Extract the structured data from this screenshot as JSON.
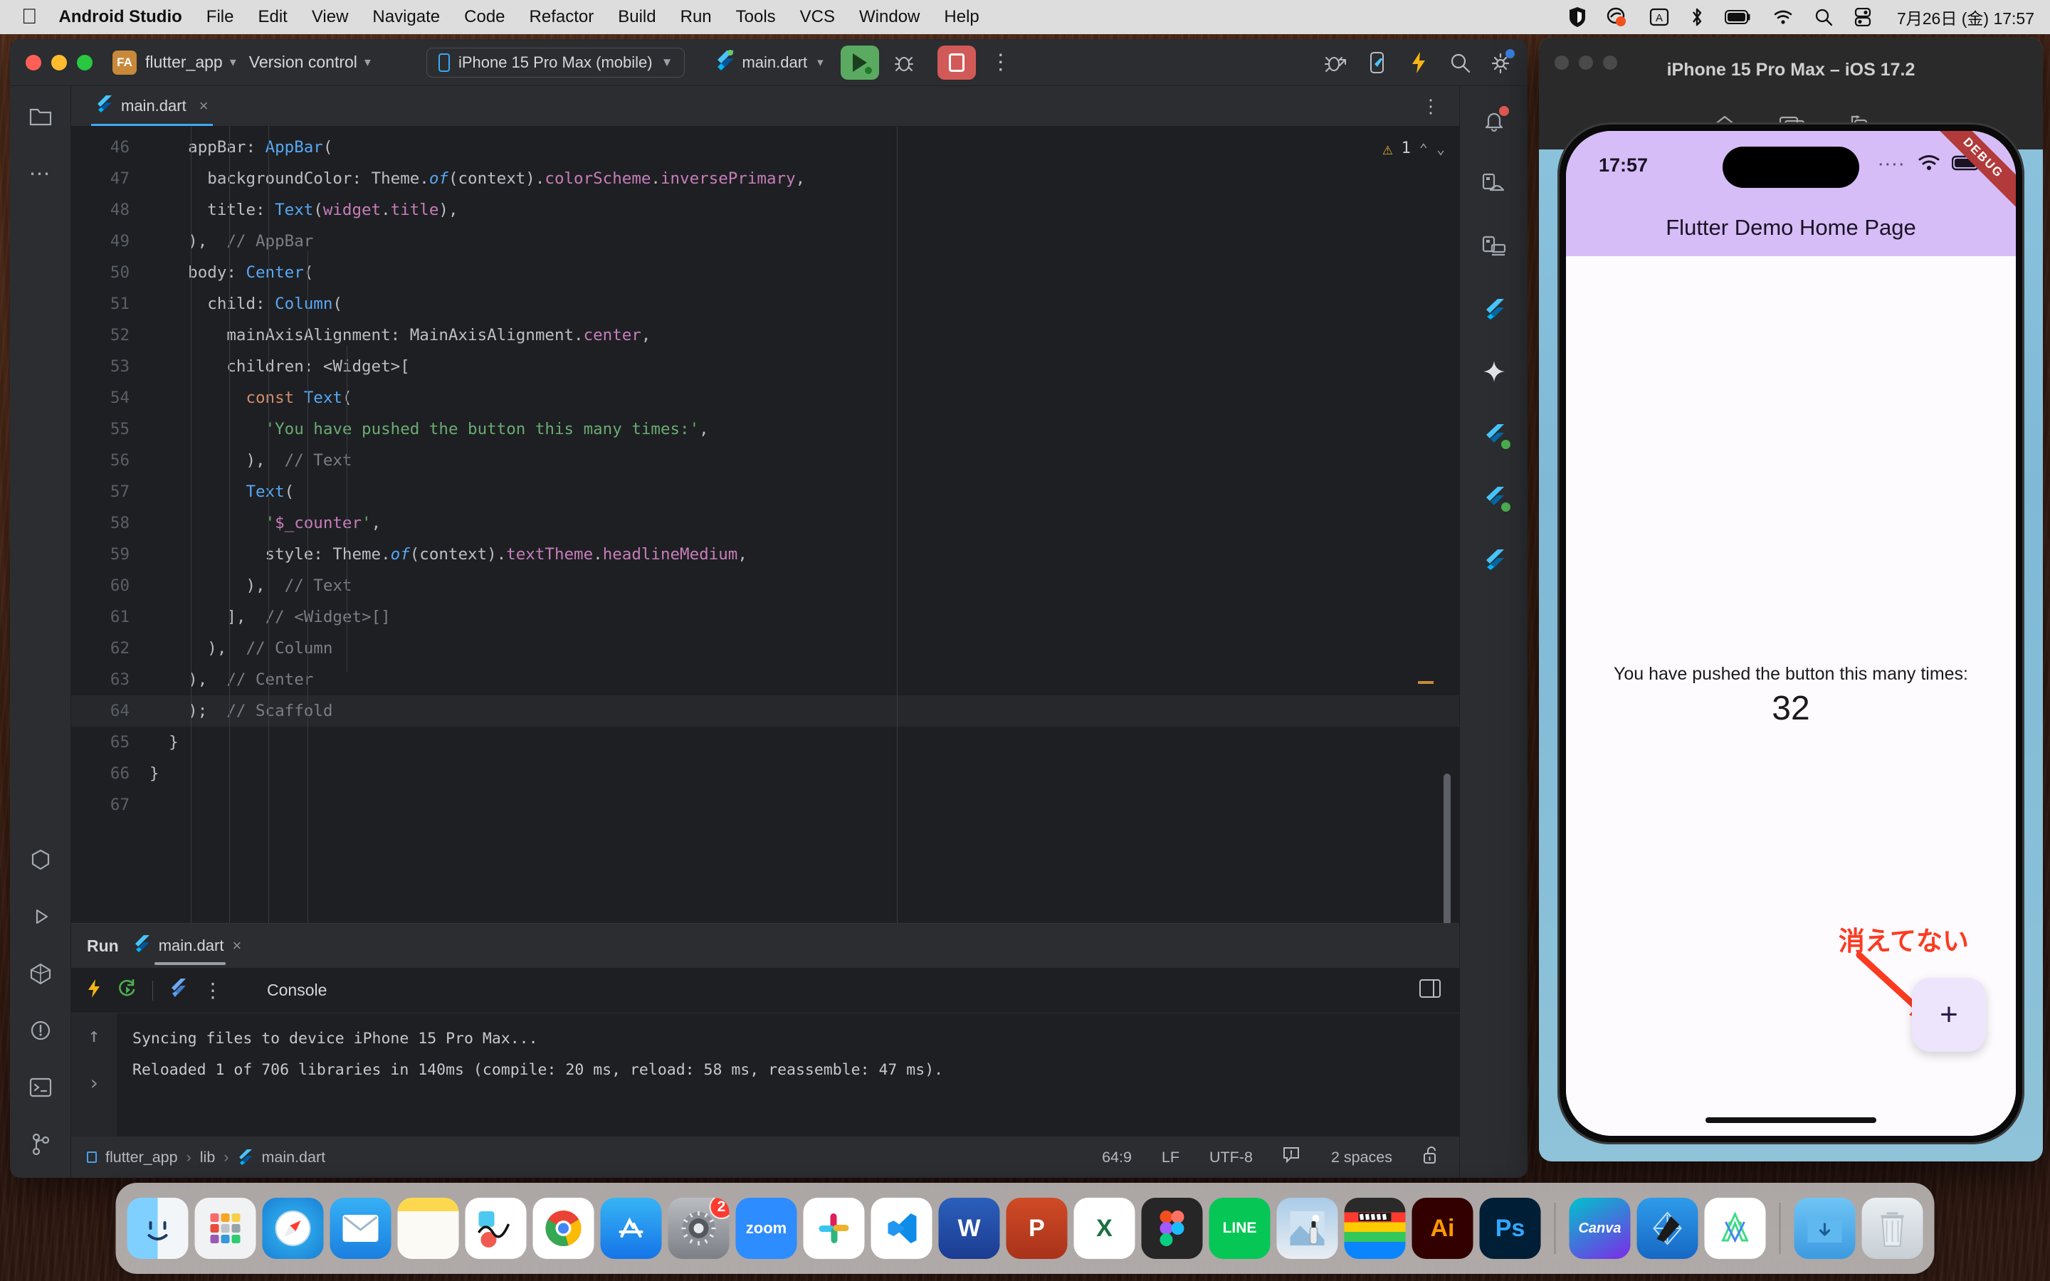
{
  "menubar": {
    "apple_icon": "apple-icon",
    "app_name": "Android Studio",
    "items": [
      "File",
      "Edit",
      "View",
      "Navigate",
      "Code",
      "Refactor",
      "Build",
      "Run",
      "Tools",
      "VCS",
      "Window",
      "Help"
    ],
    "status_icons": [
      "bitwarden-icon",
      "clipboard-icon",
      "input-source-A-icon",
      "bluetooth-icon",
      "battery-icon",
      "wifi-icon",
      "search-icon",
      "control-center-icon"
    ],
    "input_source": "A",
    "clock": "7月26日 (金)  17:57"
  },
  "ide": {
    "project_badge": "FA",
    "project_name": "flutter_app",
    "version_control": "Version control",
    "device": "iPhone 15 Pro Max (mobile)",
    "run_config": "main.dart",
    "toolbar_icons": [
      "run-button",
      "debug-button",
      "stop-button",
      "more-options-icon",
      "attach-debugger-icon",
      "device-manager-icon",
      "hot-reload-icon",
      "search-everywhere-icon",
      "settings-icon"
    ],
    "tab": {
      "label": "main.dart",
      "close": "×"
    },
    "tabbar_more": "⋮",
    "warnings": {
      "count": "1",
      "icon": "warning-triangle-icon",
      "up": "⌃",
      "down": "⌄"
    },
    "left_rail_icons": [
      "project-icon",
      "more-tools-icon",
      "bookmarks-icon",
      "run-panel-icon",
      "flutter-inspector-icon",
      "problems-icon",
      "terminal-icon",
      "version-control-icon"
    ],
    "right_rail_icons": [
      "notifications-icon",
      "android-device-icon",
      "running-devices-icon",
      "flutter-icon",
      "gemini-icon",
      "flutter-performance-icon",
      "flutter-outline-icon",
      "flutter-dev-tools-icon"
    ]
  },
  "editor": {
    "first_line_number": 46,
    "lines": [
      {
        "n": 46,
        "tokens": [
          {
            "t": "    appBar: ",
            "c": "plain"
          },
          {
            "t": "AppBar",
            "c": "type"
          },
          {
            "t": "(",
            "c": "plain"
          }
        ]
      },
      {
        "n": 47,
        "tokens": [
          {
            "t": "      backgroundColor: Theme.",
            "c": "plain"
          },
          {
            "t": "of",
            "c": "of"
          },
          {
            "t": "(context).",
            "c": "plain"
          },
          {
            "t": "colorScheme",
            "c": "prop"
          },
          {
            "t": ".",
            "c": "plain"
          },
          {
            "t": "inversePrimary",
            "c": "prop"
          },
          {
            "t": ",",
            "c": "plain"
          }
        ]
      },
      {
        "n": 48,
        "tokens": [
          {
            "t": "      title: ",
            "c": "plain"
          },
          {
            "t": "Text",
            "c": "type"
          },
          {
            "t": "(",
            "c": "plain"
          },
          {
            "t": "widget",
            "c": "var"
          },
          {
            "t": ".",
            "c": "plain"
          },
          {
            "t": "title",
            "c": "var"
          },
          {
            "t": "),",
            "c": "plain"
          }
        ]
      },
      {
        "n": 49,
        "tokens": [
          {
            "t": "    ),  ",
            "c": "plain"
          },
          {
            "t": "// AppBar",
            "c": "cmt"
          }
        ]
      },
      {
        "n": 50,
        "tokens": [
          {
            "t": "    body: ",
            "c": "plain"
          },
          {
            "t": "Center",
            "c": "type"
          },
          {
            "t": "(",
            "c": "plain"
          }
        ]
      },
      {
        "n": 51,
        "tokens": [
          {
            "t": "      child: ",
            "c": "plain"
          },
          {
            "t": "Column",
            "c": "type"
          },
          {
            "t": "(",
            "c": "plain"
          }
        ]
      },
      {
        "n": 52,
        "tokens": [
          {
            "t": "        mainAxisAlignment: MainAxisAlignment.",
            "c": "plain"
          },
          {
            "t": "center",
            "c": "prop"
          },
          {
            "t": ",",
            "c": "plain"
          }
        ]
      },
      {
        "n": 53,
        "tokens": [
          {
            "t": "        children: <Widget>[",
            "c": "plain"
          }
        ]
      },
      {
        "n": 54,
        "tokens": [
          {
            "t": "          ",
            "c": "plain"
          },
          {
            "t": "const",
            "c": "def"
          },
          {
            "t": " ",
            "c": "plain"
          },
          {
            "t": "Text",
            "c": "type"
          },
          {
            "t": "(",
            "c": "plain"
          }
        ]
      },
      {
        "n": 55,
        "tokens": [
          {
            "t": "            ",
            "c": "plain"
          },
          {
            "t": "'You have pushed the button this many times:'",
            "c": "str"
          },
          {
            "t": ",",
            "c": "plain"
          }
        ]
      },
      {
        "n": 56,
        "tokens": [
          {
            "t": "          ),  ",
            "c": "plain"
          },
          {
            "t": "// Text",
            "c": "cmt"
          }
        ]
      },
      {
        "n": 57,
        "tokens": [
          {
            "t": "          ",
            "c": "plain"
          },
          {
            "t": "Text",
            "c": "type"
          },
          {
            "t": "(",
            "c": "plain"
          }
        ]
      },
      {
        "n": 58,
        "tokens": [
          {
            "t": "            ",
            "c": "plain"
          },
          {
            "t": "'",
            "c": "str"
          },
          {
            "t": "$_counter",
            "c": "var"
          },
          {
            "t": "'",
            "c": "str"
          },
          {
            "t": ",",
            "c": "plain"
          }
        ]
      },
      {
        "n": 59,
        "tokens": [
          {
            "t": "            style: Theme.",
            "c": "plain"
          },
          {
            "t": "of",
            "c": "of"
          },
          {
            "t": "(context).",
            "c": "plain"
          },
          {
            "t": "textTheme",
            "c": "prop"
          },
          {
            "t": ".",
            "c": "plain"
          },
          {
            "t": "headlineMedium",
            "c": "prop"
          },
          {
            "t": ",",
            "c": "plain"
          }
        ]
      },
      {
        "n": 60,
        "tokens": [
          {
            "t": "          ),  ",
            "c": "plain"
          },
          {
            "t": "// Text",
            "c": "cmt"
          }
        ]
      },
      {
        "n": 61,
        "tokens": [
          {
            "t": "        ],  ",
            "c": "plain"
          },
          {
            "t": "// <Widget>[]",
            "c": "cmt"
          }
        ]
      },
      {
        "n": 62,
        "tokens": [
          {
            "t": "      ),  ",
            "c": "plain"
          },
          {
            "t": "// Column",
            "c": "cmt"
          }
        ]
      },
      {
        "n": 63,
        "tokens": [
          {
            "t": "    ),  ",
            "c": "plain"
          },
          {
            "t": "// Center",
            "c": "cmt"
          }
        ]
      },
      {
        "n": 64,
        "tokens": [
          {
            "t": "    );  ",
            "c": "plain"
          },
          {
            "t": "// Scaffold",
            "c": "cmt"
          }
        ],
        "current": true
      },
      {
        "n": 65,
        "tokens": [
          {
            "t": "  }",
            "c": "plain"
          }
        ]
      },
      {
        "n": 66,
        "tokens": [
          {
            "t": "}",
            "c": "plain"
          }
        ]
      },
      {
        "n": 67,
        "tokens": [
          {
            "t": "",
            "c": "plain"
          }
        ]
      }
    ]
  },
  "run_panel": {
    "title": "Run",
    "tab_label": "main.dart",
    "tab_close": "×",
    "console_label": "Console",
    "toolbar_icons": [
      "hot-reload-icon",
      "hot-restart-icon",
      "flutter-devtools-icon",
      "more-icon",
      "layout-settings-icon"
    ],
    "lines": [
      "Syncing files to device iPhone 15 Pro Max...",
      "Reloaded 1 of 706 libraries in 140ms (compile: 20 ms, reload: 58 ms, reassemble: 47 ms)."
    ]
  },
  "statusbar": {
    "crumbs": [
      "flutter_app",
      "lib",
      "main.dart"
    ],
    "separator": "›",
    "caret": "64:9",
    "line_ending": "LF",
    "encoding": "UTF-8",
    "inspection_icon": "inspection-icon",
    "indent": "2 spaces",
    "lock_icon": "unlocked-icon"
  },
  "simulator": {
    "window_title": "iPhone 15 Pro Max – iOS 17.2",
    "toolbar_icons": [
      "home-icon",
      "screenshot-icon",
      "rotate-icon"
    ],
    "ios_status": {
      "time": "17:57",
      "cellular": "····",
      "wifi_icon": "wifi-icon",
      "battery_icon": "battery-icon"
    },
    "debug_ribbon": "DEBUG",
    "app_title": "Flutter Demo Home Page",
    "counter_label": "You have pushed the button this many times:",
    "counter_value": "32",
    "fab_label": "+",
    "annotation": "消えてない",
    "colors": {
      "appbar": "#d6bdf7",
      "fab": "#ece5fb",
      "annotation": "#fb3b21"
    }
  },
  "dock": {
    "items": [
      {
        "name": "finder",
        "label": "",
        "type": "finder"
      },
      {
        "name": "launchpad",
        "label": "",
        "type": "launchpad"
      },
      {
        "name": "safari",
        "label": "",
        "type": "safari"
      },
      {
        "name": "mail",
        "label": "",
        "type": "mail"
      },
      {
        "name": "notes",
        "label": "",
        "type": "notes"
      },
      {
        "name": "stocks",
        "label": "",
        "type": "stocks"
      },
      {
        "name": "google-chrome",
        "label": "",
        "type": "chrome"
      },
      {
        "name": "app-store",
        "label": "A",
        "type": "appstore"
      },
      {
        "name": "system-settings",
        "label": "",
        "type": "settings",
        "badge": "2"
      },
      {
        "name": "zoom",
        "label": "zoom",
        "type": "zoom"
      },
      {
        "name": "slack",
        "label": "",
        "type": "slack"
      },
      {
        "name": "visual-studio-code",
        "label": "",
        "type": "vscode"
      },
      {
        "name": "microsoft-word",
        "label": "W",
        "type": "word"
      },
      {
        "name": "microsoft-powerpoint",
        "label": "P",
        "type": "ppt"
      },
      {
        "name": "microsoft-excel",
        "label": "X",
        "type": "excel"
      },
      {
        "name": "figma",
        "label": "",
        "type": "figma"
      },
      {
        "name": "line",
        "label": "LINE",
        "type": "line"
      },
      {
        "name": "preview",
        "label": "",
        "type": "preview"
      },
      {
        "name": "final-cut-pro",
        "label": "",
        "type": "fcp"
      },
      {
        "name": "adobe-illustrator",
        "label": "Ai",
        "type": "ai"
      },
      {
        "name": "adobe-photoshop",
        "label": "Ps",
        "type": "ps"
      }
    ],
    "items2": [
      {
        "name": "canva",
        "label": "Canva",
        "type": "canva",
        "running": true
      },
      {
        "name": "xcode",
        "label": "",
        "type": "xcode",
        "running": true
      },
      {
        "name": "android-studio",
        "label": "",
        "type": "androidstudio",
        "running": true
      }
    ],
    "items3": [
      {
        "name": "downloads-folder",
        "label": "",
        "type": "folder"
      },
      {
        "name": "trash",
        "label": "",
        "type": "trash"
      }
    ]
  }
}
